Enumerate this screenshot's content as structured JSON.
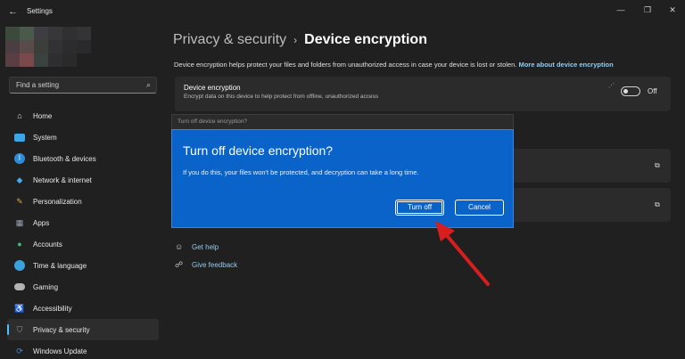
{
  "window": {
    "back_icon": "arrow-left-icon",
    "title": "Settings",
    "controls": [
      "minimize-icon",
      "maximize-icon",
      "close-icon"
    ]
  },
  "search": {
    "placeholder": "Find a setting",
    "icon": "search-icon"
  },
  "sidebar": {
    "items": [
      {
        "label": "Home",
        "icon": "home-icon",
        "color": "#e7e7e7"
      },
      {
        "label": "System",
        "icon": "monitor-icon",
        "color": "#3ca6e8"
      },
      {
        "label": "Bluetooth & devices",
        "icon": "bluetooth-icon",
        "color": "#2e8bd8"
      },
      {
        "label": "Network & internet",
        "icon": "wifi-icon",
        "color": "#4aa8e6"
      },
      {
        "label": "Personalization",
        "icon": "brush-icon",
        "color": "#e0a34a"
      },
      {
        "label": "Apps",
        "icon": "apps-icon",
        "color": "#9aa5b5"
      },
      {
        "label": "Accounts",
        "icon": "person-icon",
        "color": "#3fb97f"
      },
      {
        "label": "Time & language",
        "icon": "globe-clock-icon",
        "color": "#3ba2e0"
      },
      {
        "label": "Gaming",
        "icon": "gamepad-icon",
        "color": "#b4b4b4"
      },
      {
        "label": "Accessibility",
        "icon": "accessibility-icon",
        "color": "#4aa3e8"
      },
      {
        "label": "Privacy & security",
        "icon": "shield-icon",
        "color": "#9a9a9a",
        "active": true
      },
      {
        "label": "Windows Update",
        "icon": "update-icon",
        "color": "#3a8de0"
      }
    ]
  },
  "breadcrumb": {
    "parent": "Privacy & security",
    "separator": "›",
    "current": "Device encryption"
  },
  "description": {
    "text": "Device encryption helps protect your files and folders from unauthorized access in case your device is lost or stolen.",
    "link": "More about device encryption"
  },
  "device_encryption_card": {
    "title": "Device encryption",
    "subtitle": "Encrypt data on this device to help protect from offline, unauthorized access",
    "toggle_state": "Off"
  },
  "help": {
    "get_help": "Get help",
    "give_feedback": "Give feedback"
  },
  "dialog": {
    "window_title": "Turn off device encryption?",
    "heading": "Turn off device encryption?",
    "body": "If you do this, your files won't be protected, and decryption can take a long time.",
    "primary_button": "Turn off",
    "secondary_button": "Cancel",
    "background_color": "#0a63c9"
  },
  "annotation": {
    "arrow_color": "#d81e1e"
  }
}
